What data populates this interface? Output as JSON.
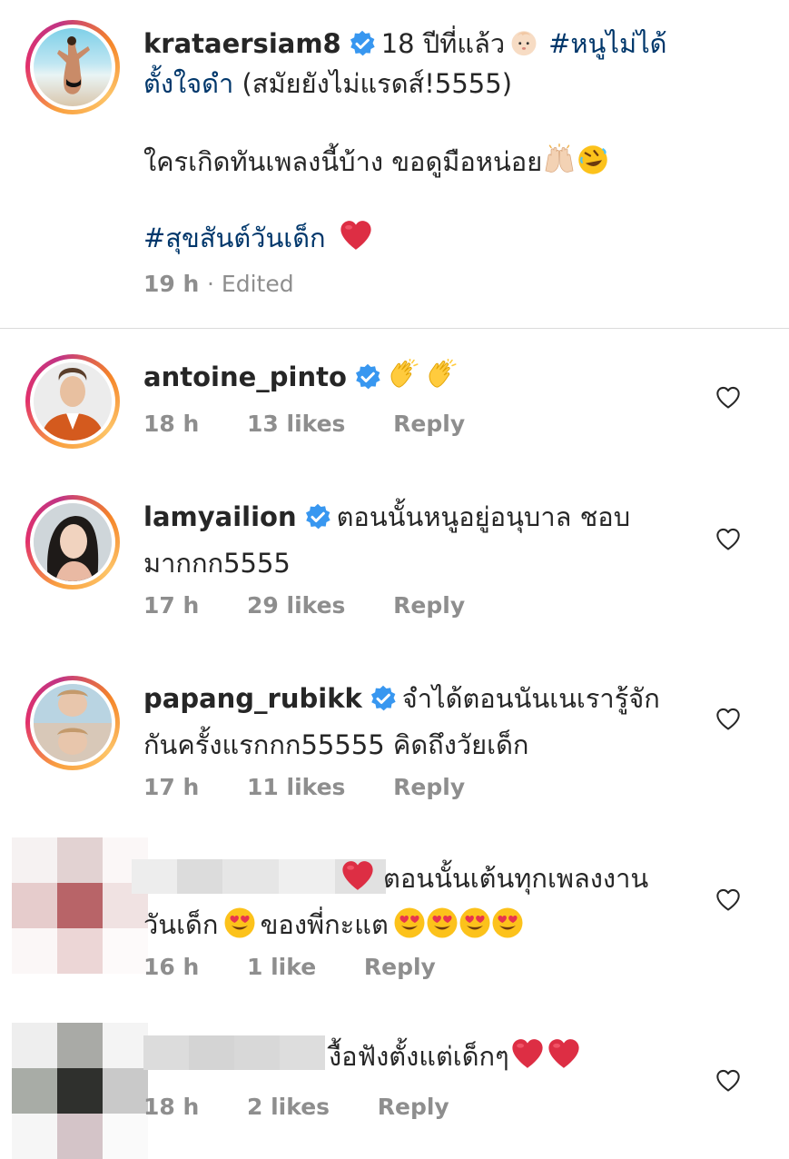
{
  "colors": {
    "text": "#262626",
    "muted": "#8e8e8e",
    "hashtag": "#00376b",
    "verified": "#3897f0",
    "heart": "#ed4956",
    "divider": "#dbdbdb"
  },
  "post": {
    "username": "krataersiam8",
    "caption_line1_a": "18 ปีที่แล้ว",
    "caption_tag1": "#หนูไม่ได้",
    "caption_tag1_cont": "ตั้งใจดำ",
    "caption_line2_b": " (สมัยยังไม่แรดส์!5555)",
    "caption_line3": "ใครเกิดทันเพลงนี้บ้าง ขอดูมือหน่อย",
    "caption_tag2": "#สุขสันต์วันเด็ก",
    "time": "19 h",
    "edited": "· Edited",
    "icons": [
      "baby-emoji",
      "raised-hands-emoji",
      "rofl-emoji",
      "red-heart-emoji"
    ]
  },
  "comments": [
    {
      "username": "antoine_pinto",
      "verified": true,
      "text": "",
      "time": "18 h",
      "likes": "13 likes",
      "reply": "Reply",
      "icons": [
        "clap-emoji",
        "clap-emoji"
      ]
    },
    {
      "username": "lamyailion",
      "verified": true,
      "text_line1": "ตอนนั้นหนูอยู่อนุบาล ชอบ",
      "text_line2": "มากกก5555",
      "time": "17 h",
      "likes": "29 likes",
      "reply": "Reply"
    },
    {
      "username": "papang_rubikk",
      "verified": true,
      "text_line1": "จำได้ตอนนันเนเรารู้จัก",
      "text_line2": "กันครั้งแรกกก55555 คิดถึงวัยเด็ก",
      "time": "17 h",
      "likes": "11 likes",
      "reply": "Reply"
    },
    {
      "username": "",
      "verified": false,
      "text_line1": "ตอนนั้นเต้นทุกเพลงงาน",
      "text_line2_a": "วันเด็ก",
      "text_line2_b": "ของพี่กะแต",
      "time": "16 h",
      "likes": "1 like",
      "reply": "Reply",
      "icons": [
        "red-heart-emoji",
        "heart-eyes-emoji"
      ]
    },
    {
      "username": "",
      "verified": false,
      "text": "งื้อฟังตั้งแต่เด็กๆ",
      "time": "18 h",
      "likes": "2 likes",
      "reply": "Reply",
      "icons": [
        "red-heart-emoji",
        "red-heart-emoji"
      ]
    }
  ]
}
